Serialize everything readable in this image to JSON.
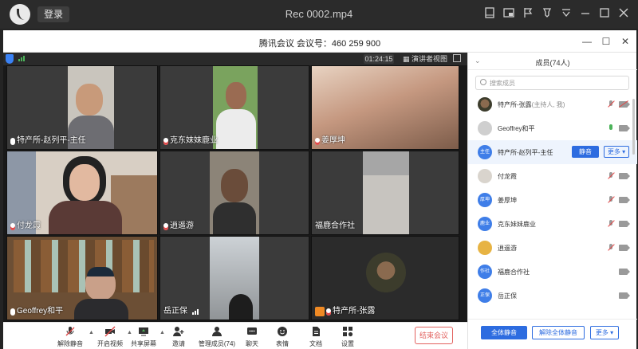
{
  "player": {
    "login_label": "登录",
    "file_title": "Rec 0002.mp4"
  },
  "meeting": {
    "title": "腾讯会议  会议号：460 259 900",
    "timer": "01:24:15",
    "speaker_view_label": "演讲者视图"
  },
  "tiles": [
    {
      "name": "特产所-赵列平-主任"
    },
    {
      "name": "克东妹妹鹿业"
    },
    {
      "name": "姜厚坤"
    },
    {
      "name": "付龙霞"
    },
    {
      "name": "逍遥游"
    },
    {
      "name": "福鹿合作社"
    },
    {
      "name": "Geoffrey和平"
    },
    {
      "name": "岳正保"
    },
    {
      "name": "特产所-张露"
    }
  ],
  "toolbar": {
    "items": [
      {
        "label": "解除静音"
      },
      {
        "label": "开启视频"
      },
      {
        "label": "共享屏幕"
      },
      {
        "label": "邀请"
      },
      {
        "label": "管理成员(74)"
      },
      {
        "label": "聊天"
      },
      {
        "label": "表情"
      },
      {
        "label": "文档"
      },
      {
        "label": "设置"
      }
    ],
    "end_label": "结束会议"
  },
  "panel": {
    "title": "成员(74人)",
    "search_placeholder": "搜索成员",
    "members": [
      {
        "name": "特产所-张露",
        "role": "(主持人, 我)",
        "avatar": "",
        "mic": "muted",
        "cam": "muted"
      },
      {
        "name": "Geoffrey和平",
        "role": "",
        "avatar": "",
        "mic": "on",
        "cam": "on"
      },
      {
        "name": "特产所-赵列平-主任",
        "role": "",
        "avatar": "主任",
        "mic": "",
        "cam": ""
      },
      {
        "name": "付龙霞",
        "role": "",
        "avatar": "",
        "mic": "muted",
        "cam": "on"
      },
      {
        "name": "姜厚坤",
        "role": "",
        "avatar": "厚坤",
        "mic": "muted",
        "cam": "on"
      },
      {
        "name": "克东妹妹鹿业",
        "role": "",
        "avatar": "鹿业",
        "mic": "muted",
        "cam": "on"
      },
      {
        "name": "逍遥游",
        "role": "",
        "avatar": "",
        "mic": "muted",
        "cam": "on"
      },
      {
        "name": "福鹿合作社",
        "role": "",
        "avatar": "作社",
        "mic": "",
        "cam": "on"
      },
      {
        "name": "岳正保",
        "role": "",
        "avatar": "正保",
        "mic": "",
        "cam": "on"
      }
    ],
    "mute_label": "静音",
    "more_label": "更多 ▾",
    "mute_all_label": "全体静音",
    "unmute_all_label": "解除全体静音",
    "footer_more_label": "更多 ▾"
  },
  "colors": {
    "accent": "#2d6ce0",
    "end_red": "#e2615e",
    "mic_on": "#4cb35a"
  }
}
